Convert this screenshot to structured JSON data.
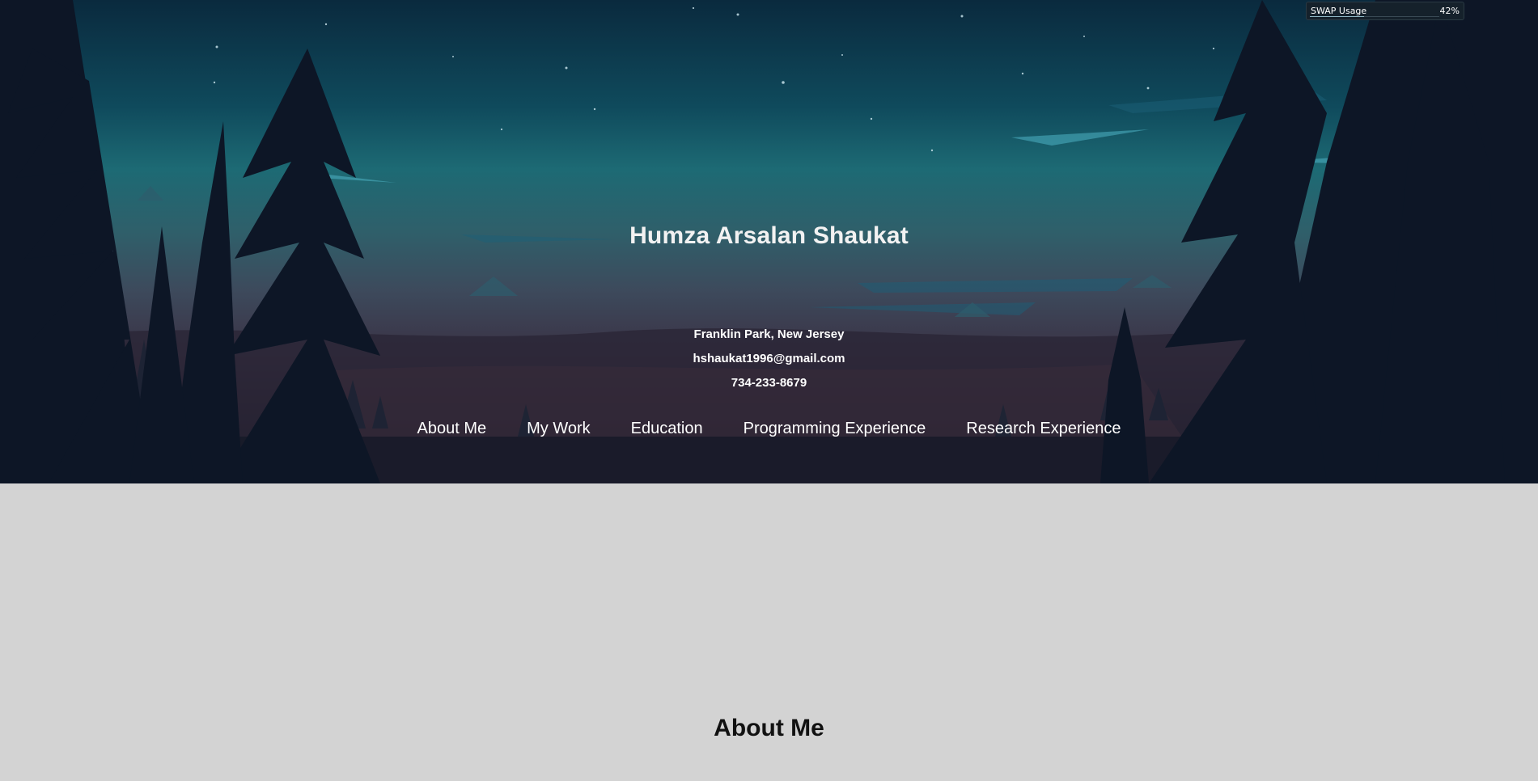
{
  "header": {
    "name": "Humza Arsalan Shaukat",
    "location": "Franklin Park, New Jersey",
    "email": "hshaukat1996@gmail.com",
    "phone": "734-233-8679"
  },
  "nav": {
    "items": [
      {
        "label": "About Me"
      },
      {
        "label": "My Work"
      },
      {
        "label": "Education"
      },
      {
        "label": "Programming Experience"
      },
      {
        "label": "Research Experience"
      }
    ]
  },
  "swap_widget": {
    "label": "SWAP Usage",
    "value_text": "42%",
    "value": 0.42
  },
  "main": {
    "about_heading": "About Me"
  },
  "colors": {
    "page_background": "#d3d3d3",
    "hero_sky": "#0f4a5c",
    "text_light": "#ffffff",
    "text_dark": "#111111"
  }
}
